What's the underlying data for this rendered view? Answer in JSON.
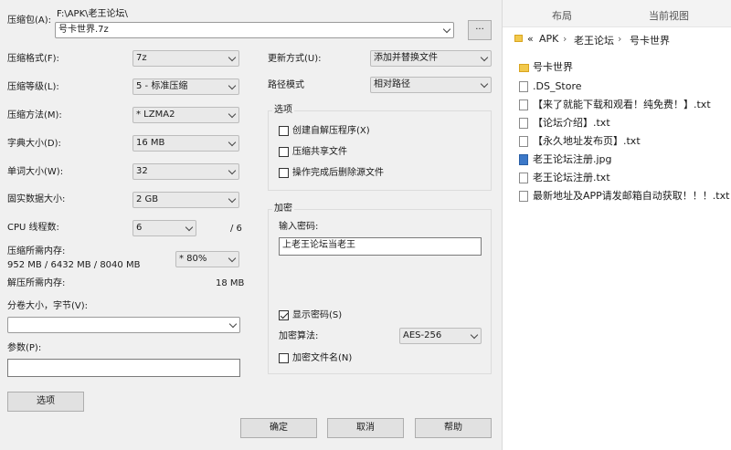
{
  "dialog": {
    "archive_label": "压缩包(A):",
    "archive_path": "F:\\APK\\老王论坛\\",
    "archive_name": "号卡世界.7z",
    "browse_button": "...",
    "format_label": "压缩格式(F):",
    "format_value": "7z",
    "level_label": "压缩等级(L):",
    "level_value": "5 - 标准压缩",
    "method_label": "压缩方法(M):",
    "method_value": "* LZMA2",
    "dict_label": "字典大小(D):",
    "dict_value": "16 MB",
    "word_label": "单词大小(W):",
    "word_value": "32",
    "solid_label": "固实数据大小:",
    "solid_value": "2 GB",
    "cpu_label": "CPU 线程数:",
    "cpu_value": "6",
    "cpu_total": "/ 6",
    "mem_label": "压缩所需内存:",
    "mem_detail": "952 MB / 6432 MB / 8040 MB",
    "mem_percent": "* 80%",
    "decomp_label": "解压所需内存:",
    "decomp_value": "18 MB",
    "split_label": "分卷大小，字节(V):",
    "split_value": "",
    "params_label": "参数(P):",
    "params_value": "",
    "options_button": "选项",
    "update_label": "更新方式(U):",
    "update_value": "添加并替换文件",
    "path_label": "路径模式",
    "path_value": "相对路径",
    "options_group": "选项",
    "opt_sfx": "创建自解压程序(X)",
    "opt_shared": "压缩共享文件",
    "opt_delete": "操作完成后删除源文件",
    "encrypt_group": "加密",
    "password_label": "输入密码:",
    "password_value": "上老王论坛当老王",
    "show_password": "显示密码(S)",
    "enc_method_label": "加密算法:",
    "enc_method_value": "AES-256",
    "encrypt_names": "加密文件名(N)",
    "ok_button": "确定",
    "cancel_button": "取消",
    "help_button": "帮助"
  },
  "explorer": {
    "tab_layout": "布局",
    "tab_view": "当前视图",
    "breadcrumb": [
      "«",
      "APK",
      "›",
      "老王论坛",
      "›",
      "号卡世界"
    ],
    "files": [
      {
        "name": "号卡世界",
        "icon": "folder-icon"
      },
      {
        "name": ".DS_Store",
        "icon": "file-icon"
      },
      {
        "name": "【来了就能下载和观看！纯免费！】.txt",
        "icon": "text-file-icon"
      },
      {
        "name": "【论坛介绍】.txt",
        "icon": "text-file-icon"
      },
      {
        "name": "【永久地址发布页】.txt",
        "icon": "text-file-icon"
      },
      {
        "name": "老王论坛注册.jpg",
        "icon": "image-file-icon"
      },
      {
        "name": "老王论坛注册.txt",
        "icon": "text-file-icon"
      },
      {
        "name": "最新地址及APP请发邮箱自动获取！！！.txt",
        "icon": "text-file-icon"
      }
    ]
  }
}
